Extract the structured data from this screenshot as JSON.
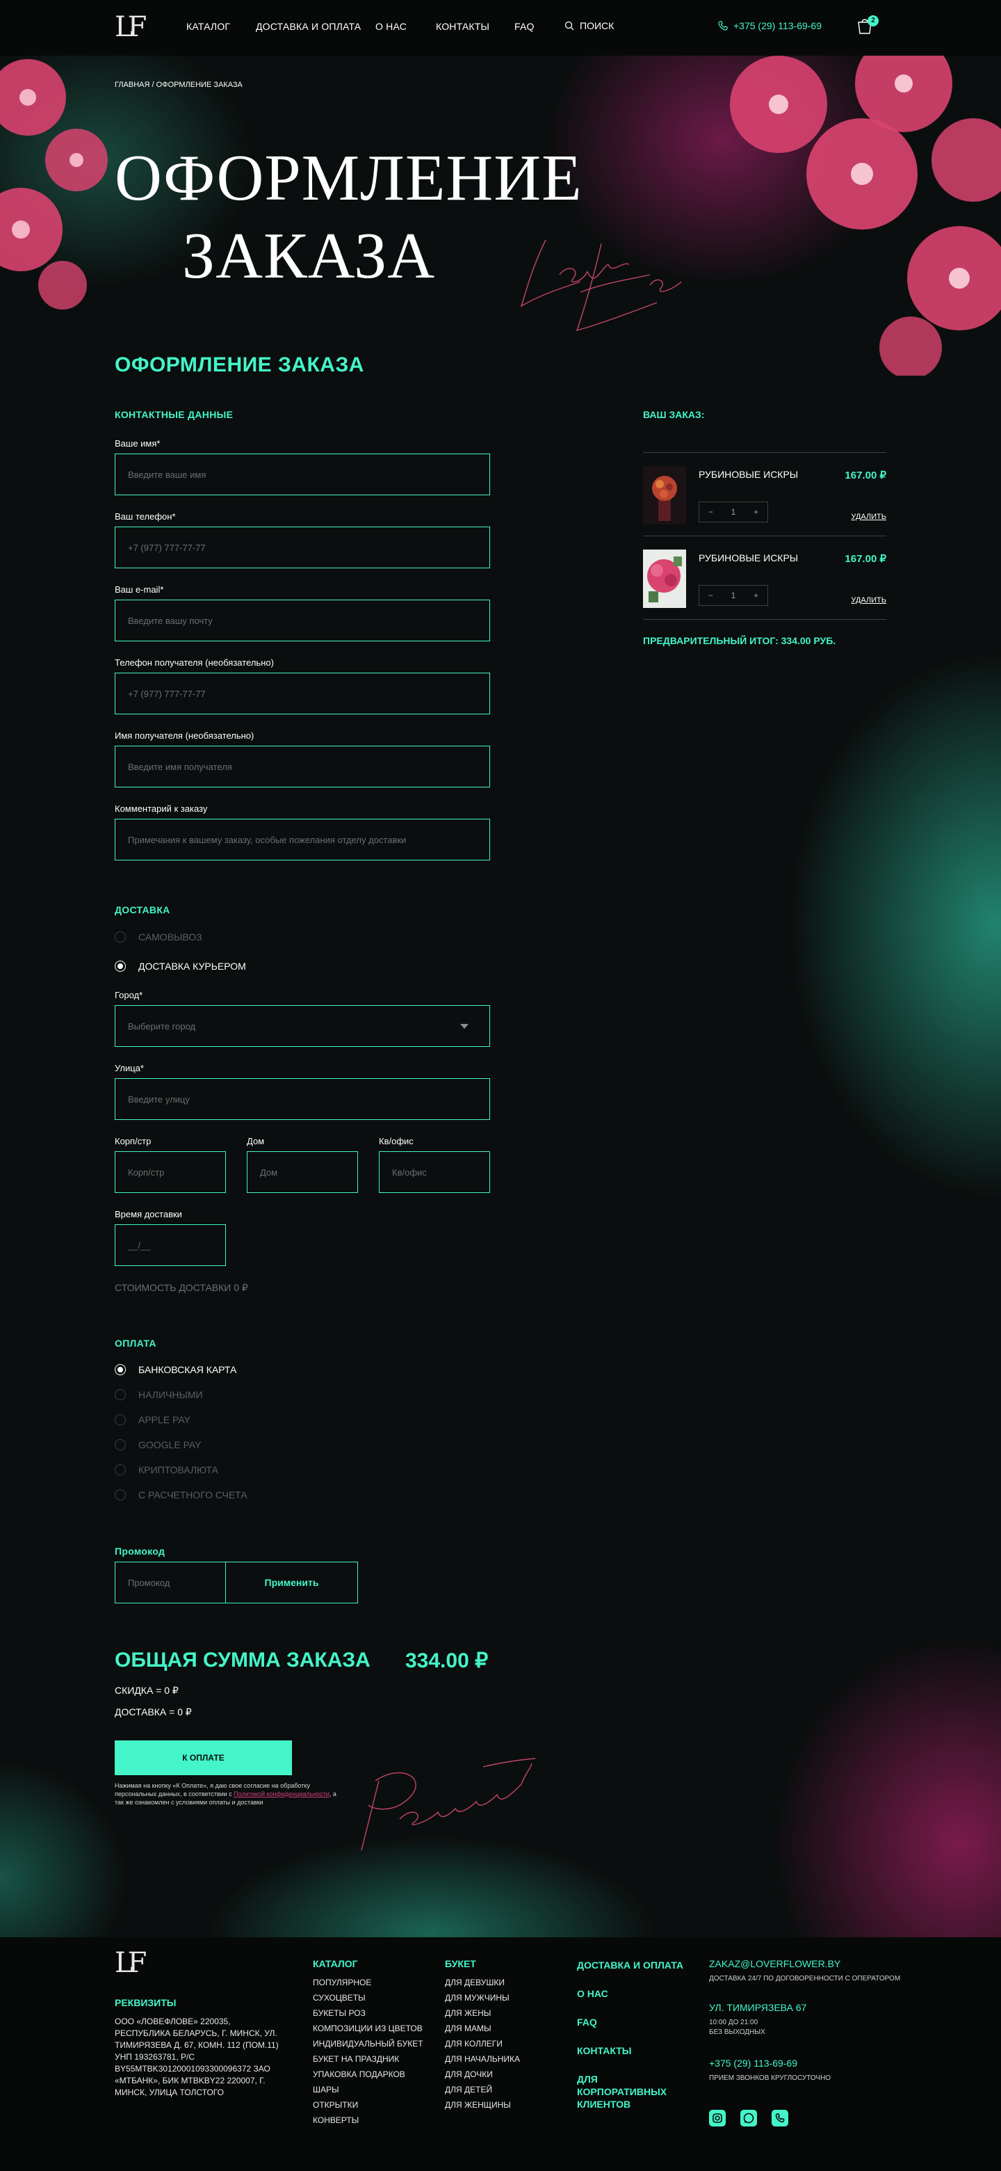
{
  "header": {
    "logo": "LF",
    "nav": [
      "КАТАЛОГ",
      "ДОСТАВКА И ОПЛАТА",
      "О НАС",
      "КОНТАКТЫ",
      "FAQ"
    ],
    "search": "ПОИСК",
    "phone": "+375 (29) 113-69-69",
    "cart_count": "2"
  },
  "breadcrumb": {
    "home": "ГЛАВНАЯ",
    "current": "ОФОРМЛЕНИЕ ЗАКАЗА"
  },
  "hero": {
    "line1": "ОФОРМЛЕНИЕ",
    "line2": "ЗАКАЗА",
    "script": "Lover Flower"
  },
  "checkout": {
    "title": "ОФОРМЛЕНИЕ ЗАКАЗА",
    "contacts": {
      "title": "КОНТАКТНЫЕ ДАННЫЕ",
      "fields": [
        {
          "label": "Ваше имя*",
          "placeholder": "Введите ваше имя"
        },
        {
          "label": "Ваш телефон*",
          "placeholder": "+7 (977) 777-77-77"
        },
        {
          "label": "Ваш e-mail*",
          "placeholder": "Введите вашу почту"
        },
        {
          "label": "Телефон получателя (необязательно)",
          "placeholder": "+7 (977) 777-77-77"
        },
        {
          "label": "Имя получателя (необязательно)",
          "placeholder": "Введите имя получателя"
        },
        {
          "label": "Комментарий к заказу",
          "placeholder": "Примечания к вашему заказу, особые пожелания отделу доставки"
        }
      ]
    },
    "delivery": {
      "title": "ДОСТАВКА",
      "options": [
        "САМОВЫВОЗ",
        "ДОСТАВКА КУРЬЕРОМ"
      ],
      "selected": "ДОСТАВКА КУРЬЕРОМ",
      "city": {
        "label": "Город*",
        "placeholder": "Выберите город"
      },
      "street": {
        "label": "Улица*",
        "placeholder": "Введите улицу"
      },
      "building": {
        "label": "Корп/стр",
        "placeholder": "Корп/стр"
      },
      "house": {
        "label": "Дом",
        "placeholder": "Дом"
      },
      "flat": {
        "label": "Кв/офис",
        "placeholder": "Кв/офис"
      },
      "time": {
        "label": "Время доставки",
        "placeholder": "__/__"
      },
      "cost": "СТОИМОСТЬ ДОСТАВКИ 0 ₽"
    },
    "payment": {
      "title": "ОПЛАТА",
      "options": [
        "БАНКОВСКАЯ КАРТА",
        "НАЛИЧНЫМИ",
        "APPLE PAY",
        "GOOGLE PAY",
        "КРИПТОВАЛЮТА",
        "С РАСЧЕТНОГО СЧЕТА"
      ],
      "selected": "БАНКОВСКАЯ КАРТА"
    },
    "promo": {
      "label": "Промокод",
      "placeholder": "Промокод",
      "apply": "Применить"
    },
    "total": {
      "label": "ОБЩАЯ СУММА ЗАКАЗА",
      "value": "334.00 ₽",
      "discount": "СКИДКА = 0 ₽",
      "delivery": "ДОСТАВКА = 0 ₽"
    },
    "pay_button": "К ОПЛАТЕ",
    "consent_text": "Нажимая на кнопку «К Оплате», я даю свое согласие на обработку персональных данных, в соответствии с ",
    "consent_link": "Политикой конфиденциальности",
    "consent_tail": ", а так же ознакомлен с условиями оплаты и доставки",
    "script": "Payment"
  },
  "order": {
    "title": "ВАШ ЗАКАЗ:",
    "items": [
      {
        "name": "РУБИНОВЫЕ ИСКРЫ",
        "price": "167.00 ₽",
        "qty": "1",
        "remove": "УДАЛИТЬ"
      },
      {
        "name": "РУБИНОВЫЕ ИСКРЫ",
        "price": "167.00 ₽",
        "qty": "1",
        "remove": "УДАЛИТЬ"
      }
    ],
    "subtotal": "ПРЕДВАРИТЕЛЬНЫЙ ИТОГ: 334.00 РУБ."
  },
  "footer": {
    "logo": "LF",
    "requisites_title": "РЕКВИЗИТЫ",
    "requisites": "ООО «ЛОВЕФЛОВЕ» 220035, РЕСПУБЛИКА БЕЛАРУСЬ, Г. МИНСК, УЛ. ТИМИРЯЗЕВА Д. 67, КОМН. 112 (ПОМ.11) УНП 193263781, Р/С BY55MTBK30120001093300096372 ЗАО «МТБАНК», БИК MTBKBY22 220007, Г. МИНСК, УЛИЦА ТОЛСТОГО",
    "catalog_title": "КАТАЛОГ",
    "catalog": [
      "ПОПУЛЯРНОЕ",
      "СУХОЦВЕТЫ",
      "БУКЕТЫ РОЗ",
      "КОМПОЗИЦИИ ИЗ ЦВЕТОВ",
      "ИНДИВИДУАЛЬНЫЙ БУКЕТ",
      "БУКЕТ НА ПРАЗДНИК",
      "УПАКОВКА ПОДАРКОВ",
      "ШАРЫ",
      "ОТКРЫТКИ",
      "КОНВЕРТЫ"
    ],
    "bouquet_title": "БУКЕТ",
    "bouquet": [
      "ДЛЯ ДЕВУШКИ",
      "ДЛЯ МУЖЧИНЫ",
      "ДЛЯ ЖЕНЫ",
      "ДЛЯ МАМЫ",
      "ДЛЯ КОЛЛЕГИ",
      "ДЛЯ НАЧАЛЬНИКА",
      "ДЛЯ ДОЧКИ",
      "ДЛЯ ДЕТЕЙ",
      "ДЛЯ ЖЕНЩИНЫ"
    ],
    "links": [
      "ДОСТАВКА И ОПЛАТА",
      "О НАС",
      "FAQ",
      "КОНТАКТЫ",
      "ДЛЯ КОРПОРАТИВНЫХ КЛИЕНТОВ"
    ],
    "email": "ZAKAZ@LOVERFLOWER.BY",
    "email_note": "ДОСТАВКА 24/7 ПО ДОГОВОРЕННОСТИ С ОПЕРАТОРОМ",
    "address": "УЛ. ТИМИРЯЗЕВА 67",
    "hours1": "10:00 ДО 21:00",
    "hours2": "БЕЗ ВЫХОДНЫХ",
    "phone": "+375 (29) 113-69-69",
    "phone_note": "ПРИЕМ ЗВОНКОВ КРУГЛОСУТОЧНО",
    "social": [
      "instagram-icon",
      "whatsapp-icon",
      "viber-icon"
    ]
  },
  "colors": {
    "accent": "#43f5c9",
    "background": "#0b0e0e",
    "pink": "#d23e7c"
  }
}
